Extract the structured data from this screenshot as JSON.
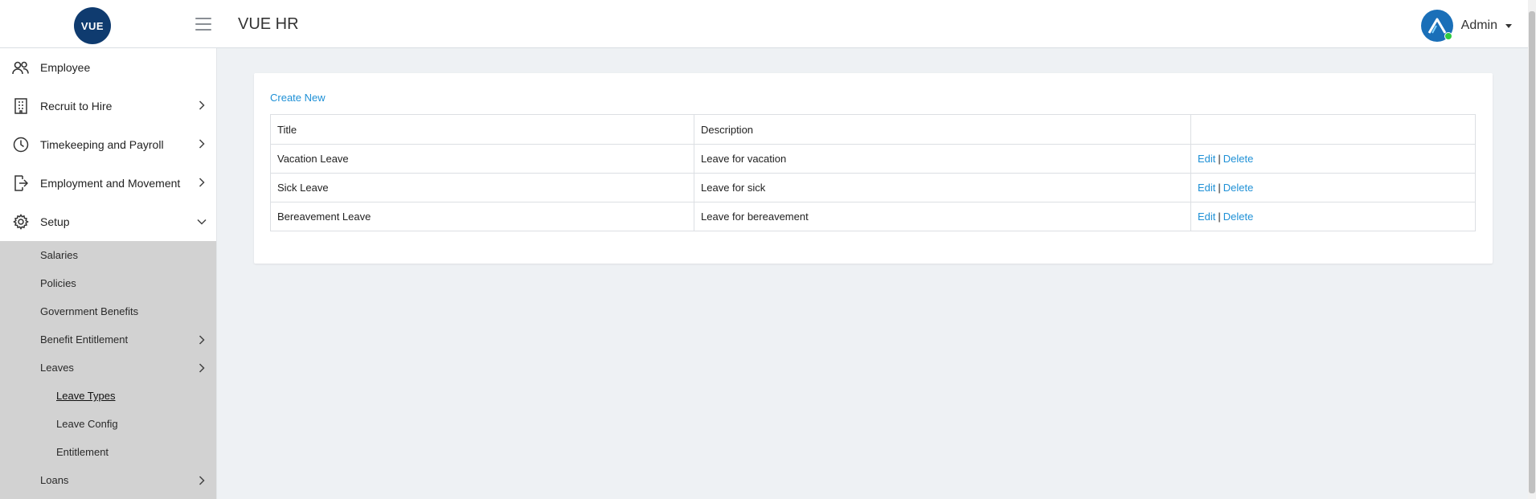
{
  "header": {
    "logo_text": "VUE",
    "app_title": "VUE HR",
    "user_name": "Admin"
  },
  "sidebar": {
    "items": [
      {
        "label": "Employee",
        "icon": "users-icon"
      },
      {
        "label": "Recruit to Hire",
        "icon": "building-icon"
      },
      {
        "label": "Timekeeping and Payroll",
        "icon": "clock-icon"
      },
      {
        "label": "Employment and Movement",
        "icon": "exit-door-icon"
      },
      {
        "label": "Setup",
        "icon": "gear-icon"
      }
    ],
    "setup_submenu": [
      {
        "label": "Salaries"
      },
      {
        "label": "Policies"
      },
      {
        "label": "Government Benefits"
      },
      {
        "label": "Benefit Entitlement"
      },
      {
        "label": "Leaves"
      },
      {
        "label": "Leave Types"
      },
      {
        "label": "Leave Config"
      },
      {
        "label": "Entitlement"
      },
      {
        "label": "Loans"
      }
    ]
  },
  "main": {
    "create_label": "Create New",
    "table": {
      "columns": [
        "Title",
        "Description",
        ""
      ],
      "rows": [
        {
          "title": "Vacation Leave",
          "description": "Leave for vacation",
          "edit": "Edit",
          "sep": "|",
          "delete": "Delete"
        },
        {
          "title": "Sick Leave",
          "description": "Leave for sick",
          "edit": "Edit",
          "sep": "|",
          "delete": "Delete"
        },
        {
          "title": "Bereavement Leave",
          "description": "Leave for bereavement",
          "edit": "Edit",
          "sep": "|",
          "delete": "Delete"
        }
      ]
    }
  },
  "colors": {
    "brand_navy": "#0f3b6f",
    "link_blue": "#1e90d6",
    "submenu_bg": "#d2d2d2",
    "content_bg": "#eef1f4"
  }
}
